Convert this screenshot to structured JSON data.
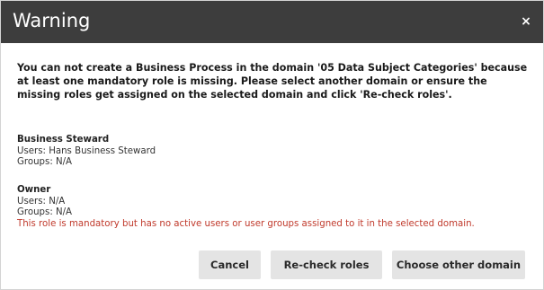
{
  "dialog": {
    "title": "Warning",
    "close_symbol": "×",
    "message": "You can not create a Business Process in the domain '05 Data Subject Categories' because at least one mandatory role is missing. Please select another domain or ensure the missing roles get assigned on the selected domain and click 'Re-check roles'."
  },
  "roles": [
    {
      "name": "Business Steward",
      "users": "Users: Hans Business Steward",
      "groups": "Groups: N/A"
    },
    {
      "name": "Owner",
      "users": "Users: N/A",
      "groups": "Groups: N/A",
      "warning": "This role is mandatory but has no active users or user groups assigned to it in the selected domain."
    }
  ],
  "buttons": {
    "cancel": "Cancel",
    "recheck": "Re-check roles",
    "choose": "Choose other domain"
  },
  "colors": {
    "titlebar": "#3d3d3d",
    "warning_text": "#c0392b",
    "button_bg": "#e4e4e4"
  },
  "icons": {
    "close": "close-icon"
  }
}
